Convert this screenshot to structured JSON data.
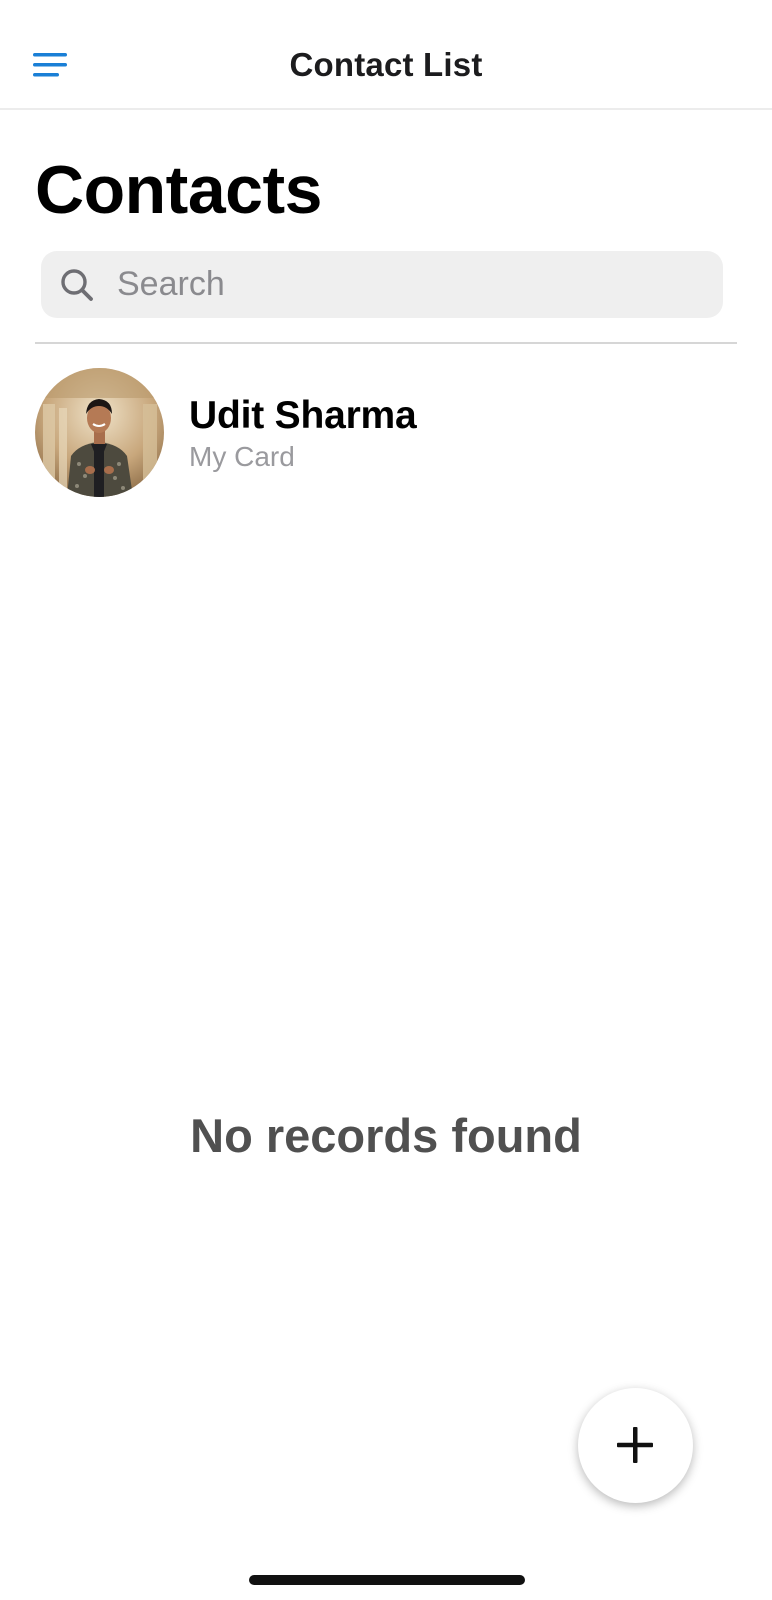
{
  "navbar": {
    "title": "Contact List",
    "menu_icon": "hamburger-menu-icon",
    "accent_color": "#1a7fd6"
  },
  "page": {
    "title": "Contacts"
  },
  "search": {
    "placeholder": "Search",
    "value": "",
    "icon": "search-icon"
  },
  "contacts": [
    {
      "name": "Udit Sharma",
      "subtitle": "My Card",
      "avatar": "profile-photo"
    }
  ],
  "empty_state": {
    "message": "No records found"
  },
  "fab": {
    "icon": "plus-icon"
  }
}
